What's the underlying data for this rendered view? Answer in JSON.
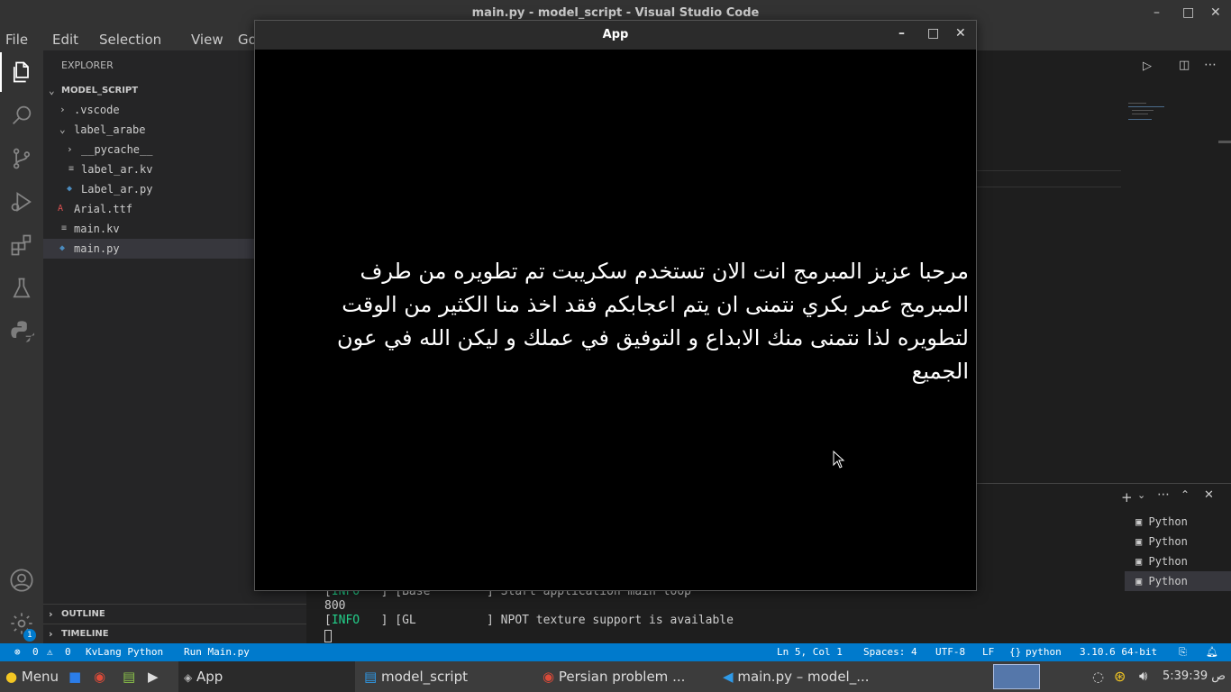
{
  "window": {
    "title": "main.py - model_script - Visual Studio Code",
    "controls": [
      "–",
      "□",
      "✕"
    ]
  },
  "menu": [
    "File",
    "Edit",
    "Selection",
    "View",
    "Go"
  ],
  "activity_bar": [
    "files-icon",
    "search-icon",
    "source-control-icon",
    "run-debug-icon",
    "extensions-icon",
    "testing-icon",
    "python-icon",
    "account-icon",
    "settings-icon"
  ],
  "settings_badge": "1",
  "explorer": {
    "title": "EXPLORER",
    "root": "MODEL_SCRIPT",
    "items": [
      {
        "label": ".vscode",
        "kind": "folder-collapsed"
      },
      {
        "label": "label_arabe",
        "kind": "folder-expanded"
      },
      {
        "label": "__pycache__",
        "kind": "folder-collapsed"
      },
      {
        "label": "label_ar.kv",
        "kind": "file"
      },
      {
        "label": "Label_ar.py",
        "kind": "python"
      },
      {
        "label": "Arial.ttf",
        "kind": "font"
      },
      {
        "label": "main.kv",
        "kind": "file"
      },
      {
        "label": "main.py",
        "kind": "python"
      }
    ],
    "outline": "OUTLINE",
    "timeline": "TIMELINE"
  },
  "terminal": {
    "lines": [
      {
        "tag": "INFO",
        "rest": "   ] [Base        ] Start application main loop"
      },
      {
        "tag": "",
        "rest": "800"
      },
      {
        "tag": "INFO",
        "rest": "   ] [GL          ] NPOT texture support is available"
      }
    ],
    "instances": [
      "Python",
      "Python",
      "Python",
      "Python"
    ]
  },
  "status": {
    "errors": "0",
    "warnings": "0",
    "left_items": [
      "KvLang Python",
      "Run Main.py"
    ],
    "position": "Ln 5, Col 1",
    "spaces": "Spaces: 4",
    "encoding": "UTF-8",
    "eol": "LF",
    "language": "python",
    "interpreter": "3.10.6 64-bit"
  },
  "app": {
    "title": "App",
    "text": "مرحبا عزيز المبرمج انت الان تستخدم سكريبت تم تطويره من طرف المبرمج عمر بكري نتمنى ان يتم اعجابكم فقد اخذ منا الكثير من الوقت لتطويره لذا نتمنى منك الابداع و التوفيق في عملك و ليكن الله في عون الجميع"
  },
  "taskbar": {
    "menu": "Menu",
    "tasks": [
      "App",
      "model_script",
      "Persian problem ...",
      "main.py – model_..."
    ],
    "clock": "5:39:39 ص"
  },
  "colors": {
    "accent": "#007acc",
    "info": "#23d18b"
  }
}
